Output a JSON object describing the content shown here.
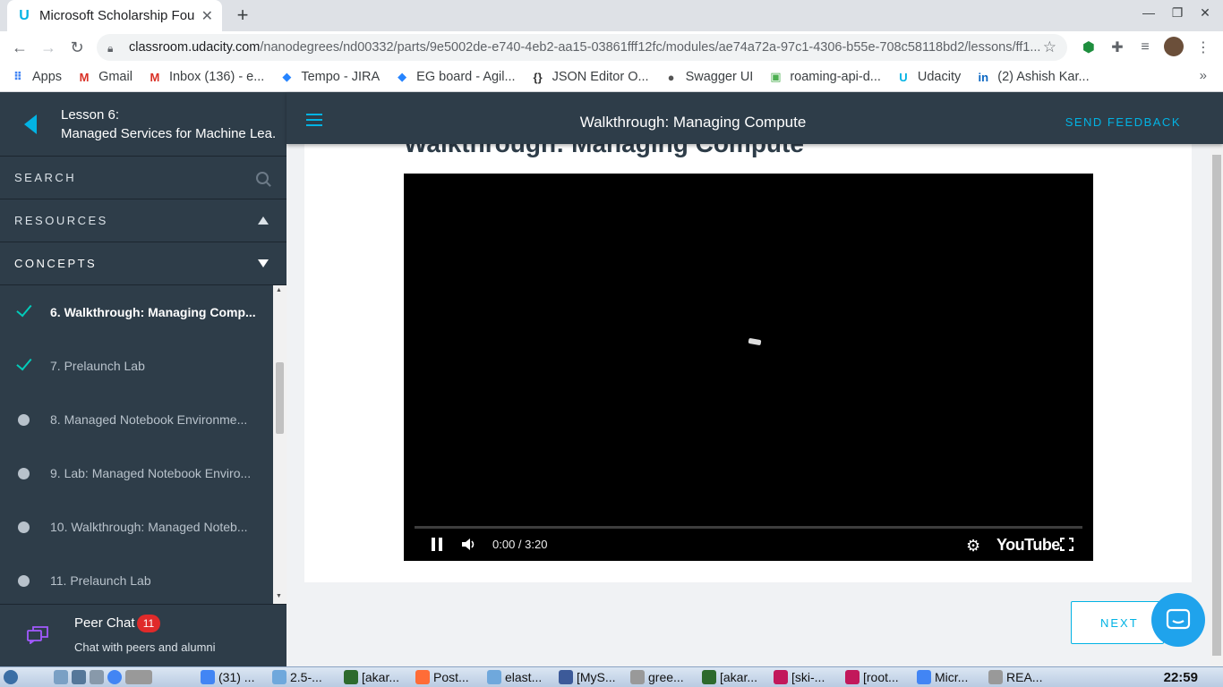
{
  "browser": {
    "tab_title": "Microsoft Scholarship Fou",
    "url_host": "classroom.udacity.com",
    "url_path": "/nanodegrees/nd00332/parts/9e5002de-e740-4eb2-aa15-03861fff12fc/modules/ae74a72a-97c1-4306-b55e-708c58118bd2/lessons/ff1...",
    "bookmarks": [
      {
        "label": "Apps",
        "icon": "apps-grid-icon",
        "color": "#4285f4"
      },
      {
        "label": "Gmail",
        "icon": "gmail-icon",
        "color": "#d93025"
      },
      {
        "label": "Inbox (136) - e...",
        "icon": "gmail-icon",
        "color": "#d93025"
      },
      {
        "label": "Tempo - JIRA",
        "icon": "jira-icon",
        "color": "#2684ff"
      },
      {
        "label": "EG board - Agil...",
        "icon": "jira-icon",
        "color": "#2684ff"
      },
      {
        "label": "JSON Editor O...",
        "icon": "json-icon",
        "color": "#333333"
      },
      {
        "label": "Swagger UI",
        "icon": "swagger-icon",
        "color": "#555555"
      },
      {
        "label": "roaming-api-d...",
        "icon": "api-icon",
        "color": "#4caf50"
      },
      {
        "label": "Udacity",
        "icon": "udacity-icon",
        "color": "#02b3e4"
      },
      {
        "label": "(2) Ashish Kar...",
        "icon": "linkedin-icon",
        "color": "#0a66c2"
      }
    ]
  },
  "sidebar": {
    "lesson_number": "Lesson 6:",
    "lesson_title": "Managed Services for Machine Lea...",
    "search_label": "SEARCH",
    "resources_label": "RESOURCES",
    "concepts_label": "CONCEPTS",
    "concepts": [
      {
        "label": "6. Walkthrough: Managing Comp...",
        "status": "done",
        "active": true
      },
      {
        "label": "7. Prelaunch Lab",
        "status": "done",
        "active": false
      },
      {
        "label": "8. Managed Notebook Environme...",
        "status": "todo",
        "active": false
      },
      {
        "label": "9. Lab: Managed Notebook Enviro...",
        "status": "todo",
        "active": false
      },
      {
        "label": "10. Walkthrough: Managed Noteb...",
        "status": "todo",
        "active": false
      },
      {
        "label": "11. Prelaunch Lab",
        "status": "todo",
        "active": false
      }
    ],
    "peer_chat": {
      "title": "Peer Chat",
      "badge": "11",
      "subtitle": "Chat with peers and alumni"
    }
  },
  "topbar": {
    "title": "Walkthrough: Managing Compute",
    "send_feedback": "SEND FEEDBACK"
  },
  "content": {
    "heading": "Walkthrough: Managing Compute",
    "video": {
      "timecode": "0:00 / 3:20",
      "brand": "YouTube"
    },
    "next_label": "NEXT"
  },
  "taskbar": {
    "items": [
      {
        "label": "(31) ...",
        "color": "#4285f4"
      },
      {
        "label": "2.5-...",
        "color": "#6fa8dc"
      },
      {
        "label": "[akar...",
        "color": "#2d6a2d"
      },
      {
        "label": "Post...",
        "color": "#ff6c37"
      },
      {
        "label": "elast...",
        "color": "#6fa8dc"
      },
      {
        "label": "[MyS...",
        "color": "#3c5a99"
      },
      {
        "label": "gree...",
        "color": "#999999"
      },
      {
        "label": "[akar...",
        "color": "#2d6a2d"
      },
      {
        "label": "[ski-...",
        "color": "#c2185b"
      },
      {
        "label": "[root...",
        "color": "#c2185b"
      },
      {
        "label": "Micr...",
        "color": "#4285f4"
      },
      {
        "label": "REA...",
        "color": "#999999"
      }
    ],
    "clock": "22:59"
  },
  "colors": {
    "udacity_blue": "#02b3e4",
    "sidebar_bg": "#2e3d49",
    "check_green": "#02ccba",
    "badge_red": "#e02a2a"
  },
  "video_progress": 0
}
